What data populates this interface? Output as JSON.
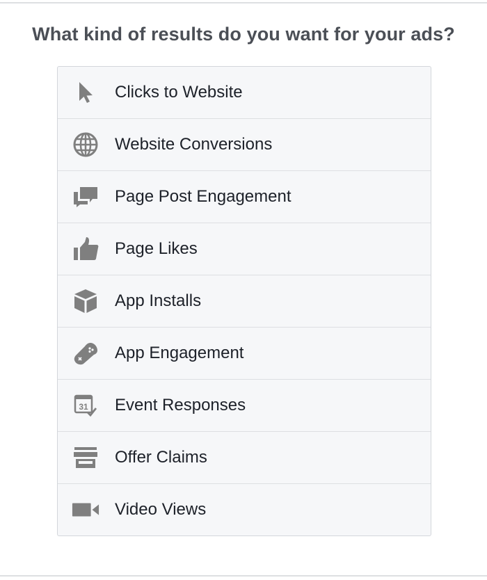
{
  "heading": "What kind of results do you want for your ads?",
  "options": [
    {
      "label": "Clicks to Website",
      "icon": "cursor-icon"
    },
    {
      "label": "Website Conversions",
      "icon": "globe-icon"
    },
    {
      "label": "Page Post Engagement",
      "icon": "chat-bubbles-icon"
    },
    {
      "label": "Page Likes",
      "icon": "thumbs-up-icon"
    },
    {
      "label": "App Installs",
      "icon": "package-icon"
    },
    {
      "label": "App Engagement",
      "icon": "gamepad-icon"
    },
    {
      "label": "Event Responses",
      "icon": "calendar-icon"
    },
    {
      "label": "Offer Claims",
      "icon": "storefront-icon"
    },
    {
      "label": "Video Views",
      "icon": "video-camera-icon"
    }
  ],
  "colors": {
    "heading_text": "#4b4f56",
    "label_text": "#1d2129",
    "icon_gray": "#7f7f7f",
    "panel_background": "#f6f7f9",
    "divider": "#dddfe2"
  }
}
